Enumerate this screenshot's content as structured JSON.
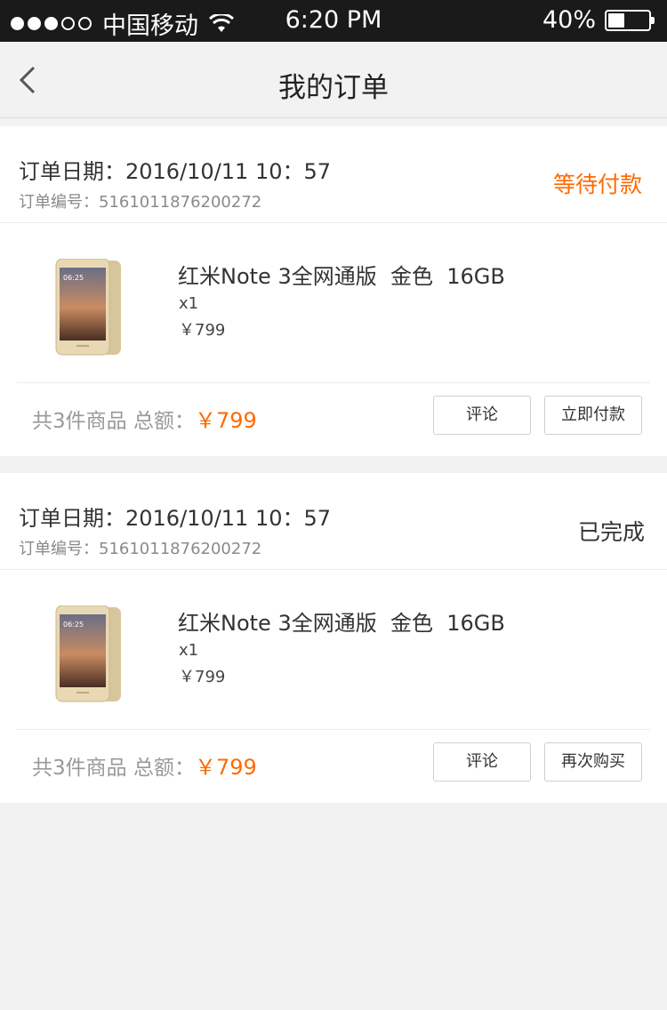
{
  "status_bar": {
    "carrier": "中国移动",
    "time": "6:20 PM",
    "battery_percent": "40%",
    "battery_level": 0.4,
    "signal_bars_filled": 3,
    "signal_bars_total": 5
  },
  "nav": {
    "back_icon": "chevron-left-icon",
    "title": "我的订单"
  },
  "orders": [
    {
      "date": "订单日期：2016/10/11  10：57",
      "number": "订单编号：5161011876200272",
      "status": "等待付款",
      "product_name": "红米Note 3全网通版  金色  16GB",
      "quantity": "x1",
      "price": "￥799",
      "total_label": "共3件商品 总额：",
      "total_amount": "￥799",
      "review_label": "评论",
      "action_label": "立即付款"
    },
    {
      "date": "订单日期：2016/10/11  10：57",
      "number": "订单编号：5161011876200272",
      "status": "已完成",
      "product_name": "红米Note 3全网通版  金色  16GB",
      "quantity": "x1",
      "price": "￥799",
      "total_label": "共3件商品 总额：",
      "total_amount": "￥799",
      "review_label": "评论",
      "action_label": "再次购买"
    }
  ],
  "colors": {
    "accent": "#ff6a00",
    "status_bar_bg": "#1a1a1a",
    "page_bg": "#f2f2f2"
  }
}
